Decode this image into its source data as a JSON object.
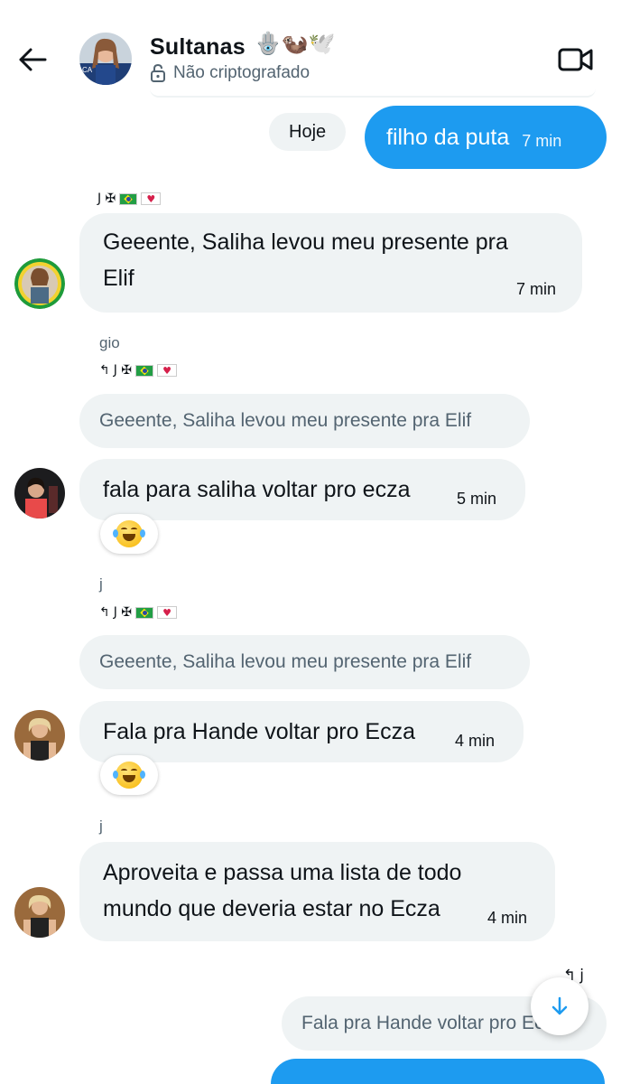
{
  "header": {
    "title": "Sultanas",
    "title_emojis": "🪬🦦🕊️",
    "encryption_status": "Não criptografado",
    "icons": {
      "back": "arrow-left-icon",
      "lock": "unlock-icon",
      "video": "video-camera-icon"
    }
  },
  "date_separator": "Hoje",
  "messages": [
    {
      "direction": "out",
      "text": "filho da puta",
      "time": "7 min"
    },
    {
      "direction": "in",
      "sender_tag": "J ✠",
      "text_line1": "Geeente, Saliha levou meu presente pra",
      "text_line2": "Elif",
      "time": "7 min"
    },
    {
      "direction": "in",
      "sender": "gio",
      "reply_tag": "J ✠",
      "quote": "Geeente, Saliha levou meu presente pra Elif",
      "text": "fala para saliha voltar pro ecza",
      "time": "5 min",
      "reaction": "laughing-tears-emoji"
    },
    {
      "direction": "in",
      "sender": "j",
      "reply_tag": "J ✠",
      "quote": "Geeente, Saliha levou meu presente pra Elif",
      "text": "Fala pra Hande voltar pro Ecza",
      "time": "4 min",
      "reaction": "laughing-tears-emoji"
    },
    {
      "direction": "in",
      "sender": "j",
      "text_line1": "Aproveita e passa uma lista de todo",
      "text_line2": "mundo que deveria estar no Ecza",
      "time": "4 min"
    },
    {
      "direction": "out",
      "reply_to": "j",
      "quote": "Fala pra Hande voltar pro Ecza"
    }
  ],
  "colors": {
    "accent": "#1d9bf0",
    "bubble_in": "#eff3f4",
    "muted_text": "#536471"
  }
}
